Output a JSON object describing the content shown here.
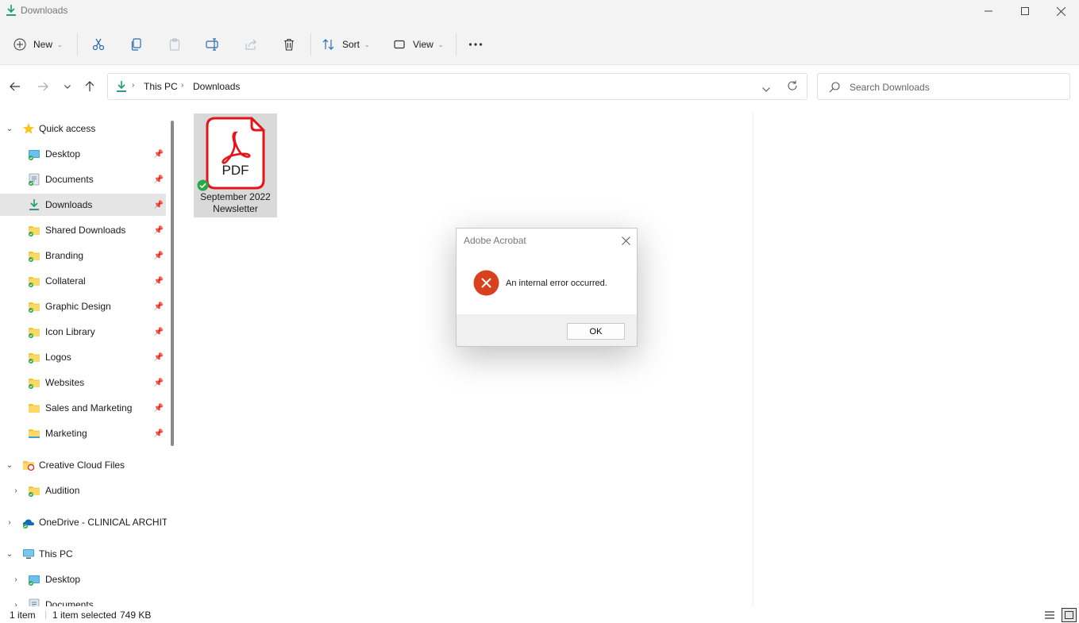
{
  "window": {
    "title": "Downloads",
    "minimize_icon": "minimize-icon",
    "maximize_icon": "maximize-icon",
    "close_icon": "close-icon"
  },
  "toolbar": {
    "new_label": "New",
    "sort_label": "Sort",
    "view_label": "View",
    "icons": [
      "cut-icon",
      "copy-icon",
      "paste-icon",
      "rename-icon",
      "share-icon",
      "delete-icon",
      "more-icon"
    ]
  },
  "address": {
    "crumbs": [
      "This PC",
      "Downloads"
    ],
    "search_placeholder": "Search Downloads"
  },
  "sidebar": {
    "quick_access": "Quick access",
    "items": [
      {
        "label": "Desktop",
        "pinned": true
      },
      {
        "label": "Documents",
        "pinned": true
      },
      {
        "label": "Downloads",
        "pinned": true,
        "selected": true
      },
      {
        "label": "Shared Downloads",
        "pinned": true
      },
      {
        "label": "Branding",
        "pinned": true
      },
      {
        "label": "Collateral",
        "pinned": true
      },
      {
        "label": "Graphic Design",
        "pinned": true
      },
      {
        "label": "Icon Library",
        "pinned": true
      },
      {
        "label": "Logos",
        "pinned": true
      },
      {
        "label": "Websites",
        "pinned": true
      },
      {
        "label": "Sales and Marketing",
        "pinned": true
      },
      {
        "label": "Marketing",
        "pinned": true
      }
    ],
    "creative_cloud": "Creative Cloud Files",
    "audition": "Audition",
    "onedrive": "OneDrive - CLINICAL ARCHITE",
    "this_pc": "This PC",
    "pc_desktop": "Desktop",
    "pc_documents": "Documents"
  },
  "files": [
    {
      "name_line1": "September 2022",
      "name_line2": "Newsletter",
      "type_badge": "PDF"
    }
  ],
  "dialog": {
    "title": "Adobe Acrobat",
    "message": "An internal error occurred.",
    "ok_label": "OK"
  },
  "status": {
    "item_count": "1 item",
    "selection": "1 item selected",
    "size": "749 KB"
  },
  "colors": {
    "accent": "#0067c0",
    "error_red": "#d9411e",
    "pdf_red": "#e3141a",
    "sync_green": "#2aa84a",
    "folder_yellow": "#f5c542"
  }
}
